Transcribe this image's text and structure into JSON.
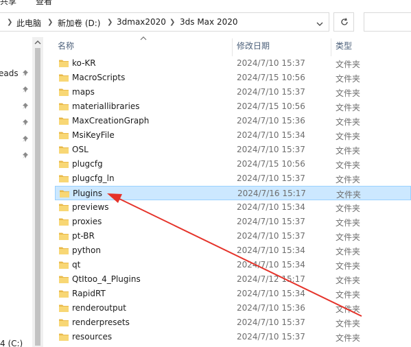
{
  "menu": {
    "items": [
      "共享",
      "查看"
    ]
  },
  "address": {
    "crumbs": [
      "此电脑",
      "新加卷 (D:)",
      "3dmax2020",
      "3ds Max 2020"
    ]
  },
  "nav": {
    "partial_label": "eads",
    "bottom_label": "4 (C:)"
  },
  "columns": {
    "name": "名称",
    "modified": "修改日期",
    "type": "类型"
  },
  "files": [
    {
      "name": "ko-KR",
      "modified": "2024/7/10 15:37",
      "type": "文件夹"
    },
    {
      "name": "MacroScripts",
      "modified": "2024/7/15 10:56",
      "type": "文件夹"
    },
    {
      "name": "maps",
      "modified": "2024/7/10 15:37",
      "type": "文件夹"
    },
    {
      "name": "materiallibraries",
      "modified": "2024/7/15 10:56",
      "type": "文件夹"
    },
    {
      "name": "MaxCreationGraph",
      "modified": "2024/7/10 15:36",
      "type": "文件夹"
    },
    {
      "name": "MsiKeyFile",
      "modified": "2024/7/10 15:34",
      "type": "文件夹"
    },
    {
      "name": "OSL",
      "modified": "2024/7/10 15:37",
      "type": "文件夹"
    },
    {
      "name": "plugcfg",
      "modified": "2024/7/15 10:56",
      "type": "文件夹"
    },
    {
      "name": "plugcfg_ln",
      "modified": "2024/7/10 15:37",
      "type": "文件夹"
    },
    {
      "name": "Plugins",
      "modified": "2024/7/16 15:17",
      "type": "文件夹",
      "selected": true
    },
    {
      "name": "previews",
      "modified": "2024/7/10 15:34",
      "type": "文件夹"
    },
    {
      "name": "proxies",
      "modified": "2024/7/10 15:37",
      "type": "文件夹"
    },
    {
      "name": "pt-BR",
      "modified": "2024/7/10 15:37",
      "type": "文件夹"
    },
    {
      "name": "python",
      "modified": "2024/7/10 15:34",
      "type": "文件夹"
    },
    {
      "name": "qt",
      "modified": "2024/7/10 15:34",
      "type": "文件夹"
    },
    {
      "name": "QtItoo_4_Plugins",
      "modified": "2024/7/12 15:17",
      "type": "文件夹"
    },
    {
      "name": "RapidRT",
      "modified": "2024/7/10 15:34",
      "type": "文件夹"
    },
    {
      "name": "renderoutput",
      "modified": "2024/7/10 15:36",
      "type": "文件夹"
    },
    {
      "name": "renderpresets",
      "modified": "2024/7/10 15:37",
      "type": "文件夹"
    },
    {
      "name": "resources",
      "modified": "2024/7/10 15:37",
      "type": "文件夹"
    }
  ],
  "colors": {
    "selection_bg": "#cce8ff",
    "selection_border": "#99d1ff",
    "folder": "#f8d775",
    "annotation_arrow": "#e5332a"
  },
  "icons": [
    "folder-icon",
    "pin-icon",
    "refresh-icon",
    "chevron-down-icon",
    "chevron-up-icon",
    "chevron-right-icon"
  ]
}
